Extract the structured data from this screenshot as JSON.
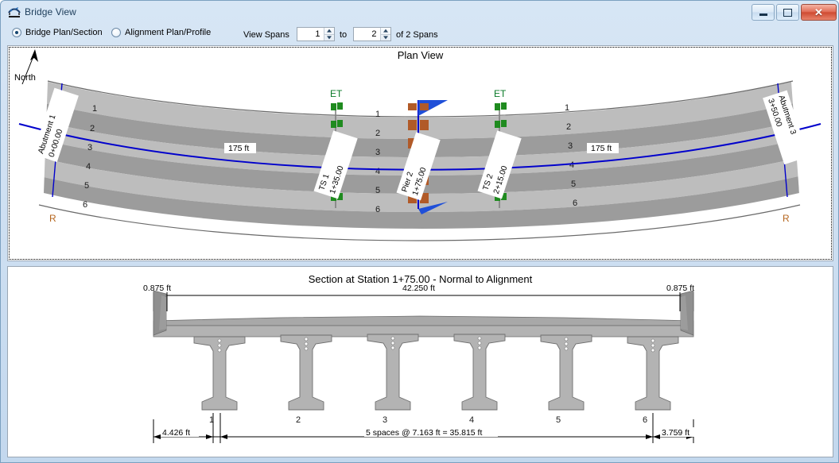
{
  "window": {
    "title": "Bridge View",
    "icon": "bridge-view-icon",
    "buttons": {
      "minimize": "minimize-icon",
      "maximize": "maximize-icon",
      "close": "close-icon"
    }
  },
  "toolbar": {
    "radios": [
      {
        "label": "Bridge Plan/Section",
        "selected": true
      },
      {
        "label": "Alignment Plan/Profile",
        "selected": false
      }
    ],
    "view_spans_label": "View Spans",
    "span_from": "1",
    "span_to": "2",
    "to_label": "to",
    "of_label": "of 2 Spans"
  },
  "plan_view": {
    "title": "Plan View",
    "north_label": "North",
    "girder_numbers": [
      "1",
      "2",
      "3",
      "4",
      "5",
      "6"
    ],
    "span_labels": [
      "175 ft",
      "175 ft"
    ],
    "et_labels": [
      "ET",
      "ET"
    ],
    "r_labels": [
      "R",
      "R"
    ],
    "supports": [
      {
        "name": "Abutment 1",
        "station": "0+00.00"
      },
      {
        "name": "TS 1",
        "station": "1+35.00"
      },
      {
        "name": "Pier 2",
        "station": "1+75.00"
      },
      {
        "name": "TS 2",
        "station": "2+15.00"
      },
      {
        "name": "Abutment 3",
        "station": "3+50.00"
      }
    ],
    "colors": {
      "alignment": "#0000cc",
      "deck_light": "#bdbdbd",
      "deck_dark": "#949494",
      "support_green": "#1f8b1f",
      "pier_orange": "#b15a28",
      "et_text": "#0a7a28",
      "r_text": "#b5651d"
    }
  },
  "section_view": {
    "title": "Section at Station 1+75.00 - Normal to Alignment",
    "top_dims": {
      "left_overhang": "0.875 ft",
      "total_width": "42.250 ft",
      "right_overhang": "0.875 ft"
    },
    "bottom_dims": {
      "left_edge": "4.426 ft",
      "spacing": "5 spaces @ 7.163 ft = 35.815 ft",
      "right_edge": "3.759 ft"
    },
    "girder_numbers": [
      "1",
      "2",
      "3",
      "4",
      "5",
      "6"
    ],
    "colors": {
      "concrete": "#b3b3b3",
      "concrete_dark": "#8f8f8f",
      "outline": "#6e6e6e"
    }
  }
}
